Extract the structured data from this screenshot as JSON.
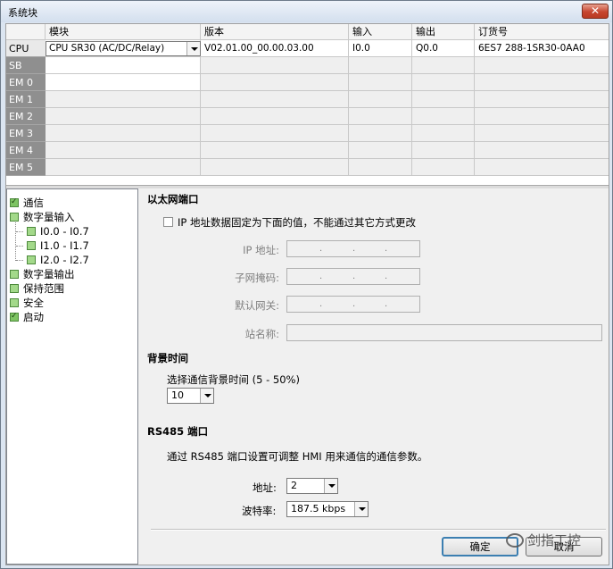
{
  "window": {
    "title": "系统块",
    "close": "✕"
  },
  "grid": {
    "headers": [
      "模块",
      "版本",
      "输入",
      "输出",
      "订货号"
    ],
    "rows": [
      {
        "label": "CPU",
        "module": "CPU SR30 (AC/DC/Relay)",
        "version": "V02.01.00_00.00.03.00",
        "input": "I0.0",
        "output": "Q0.0",
        "order": "6ES7 288-1SR30-0AA0"
      },
      {
        "label": "SB"
      },
      {
        "label": "EM 0"
      },
      {
        "label": "EM 1"
      },
      {
        "label": "EM 2"
      },
      {
        "label": "EM 3"
      },
      {
        "label": "EM 4"
      },
      {
        "label": "EM 5"
      }
    ]
  },
  "tree": {
    "items": [
      {
        "label": "通信",
        "checked": true
      },
      {
        "label": "数字量输入",
        "checked": false
      },
      {
        "label": "I0.0 - I0.7",
        "checked": false
      },
      {
        "label": "I1.0 - I1.7",
        "checked": false
      },
      {
        "label": "I2.0 - I2.7",
        "checked": false
      },
      {
        "label": "数字量输出",
        "checked": false
      },
      {
        "label": "保持范围",
        "checked": false
      },
      {
        "label": "安全",
        "checked": false
      },
      {
        "label": "启动",
        "checked": true
      }
    ]
  },
  "ethernet": {
    "heading": "以太网端口",
    "fixed_ip_label": "IP 地址数据固定为下面的值，不能通过其它方式更改",
    "ip_label": "IP 地址:",
    "subnet_label": "子网掩码:",
    "gateway_label": "默认网关:",
    "station_label": "站名称:",
    "dot": "."
  },
  "background": {
    "heading": "背景时间",
    "select_label": "选择通信背景时间 (5 - 50%)",
    "value": "10"
  },
  "rs485": {
    "heading": "RS485 端口",
    "description": "通过 RS485 端口设置可调整 HMI 用来通信的通信参数。",
    "address_label": "地址:",
    "address_value": "2",
    "baud_label": "波特率:",
    "baud_value": "187.5 kbps"
  },
  "buttons": {
    "ok": "确定",
    "cancel": "取消"
  },
  "watermark": "剑指工控"
}
